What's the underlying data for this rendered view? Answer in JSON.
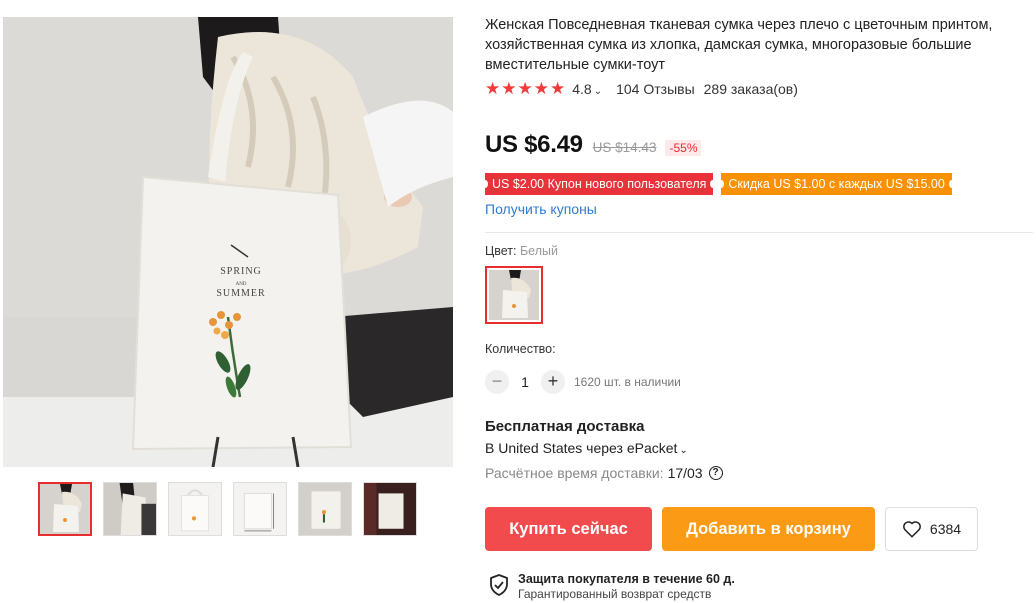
{
  "product": {
    "title": "Женская Повседневная тканевая сумка через плечо с цветочным принтом, хозяйственная сумка из хлопка, дамская сумка, многоразовые большие вместительные сумки-тоут",
    "rating": "4.8",
    "rating_stars": 5,
    "reviews": "104 Отзывы",
    "orders": "289 заказа(ов)",
    "bag_print_line1": "SPRING",
    "bag_print_line2": "AND",
    "bag_print_line3": "SUMMER"
  },
  "pricing": {
    "price": "US $6.49",
    "old_price": "US $14.43",
    "discount": "-55%"
  },
  "coupons": [
    {
      "label": "US $2.00 Купон нового пользователя",
      "color": "#e8333b"
    },
    {
      "label": "Скидка US $1.00 с каждых US $15.00",
      "color": "#fb9000"
    }
  ],
  "get_coupons_label": "Получить купоны",
  "variant": {
    "color_label": "Цвет:",
    "color_value": "Белый"
  },
  "quantity": {
    "label": "Количество:",
    "minus": "−",
    "plus": "+",
    "value": "1",
    "stock": "1620 шт. в наличии"
  },
  "shipping": {
    "title": "Бесплатная доставка",
    "to": "В United States через ePacket",
    "est_label": "Расчётное время доставки:",
    "est_date": "17/03",
    "help": "?"
  },
  "actions": {
    "buy_now": "Купить сейчас",
    "add_to_cart": "Добавить в корзину",
    "wishlist_count": "6384"
  },
  "protection": {
    "title": "Защита покупателя в течение 60 д.",
    "subtitle": "Гарантированный возврат средств"
  },
  "thumbnails": [
    {
      "name": "thumb-1",
      "active": true
    },
    {
      "name": "thumb-2",
      "active": false
    },
    {
      "name": "thumb-3",
      "active": false
    },
    {
      "name": "thumb-4",
      "active": false
    },
    {
      "name": "thumb-5",
      "active": false
    },
    {
      "name": "thumb-6",
      "active": false
    }
  ],
  "icons": {
    "star": "star-icon",
    "chevron": "chevron-down-icon",
    "help": "question-circle-icon",
    "heart": "heart-icon",
    "shield": "shield-check-icon"
  },
  "colors": {
    "accent_red": "#f24b4e",
    "accent_orange": "#fb9a14",
    "star": "#f33a3a",
    "link": "#2f7ccf"
  }
}
